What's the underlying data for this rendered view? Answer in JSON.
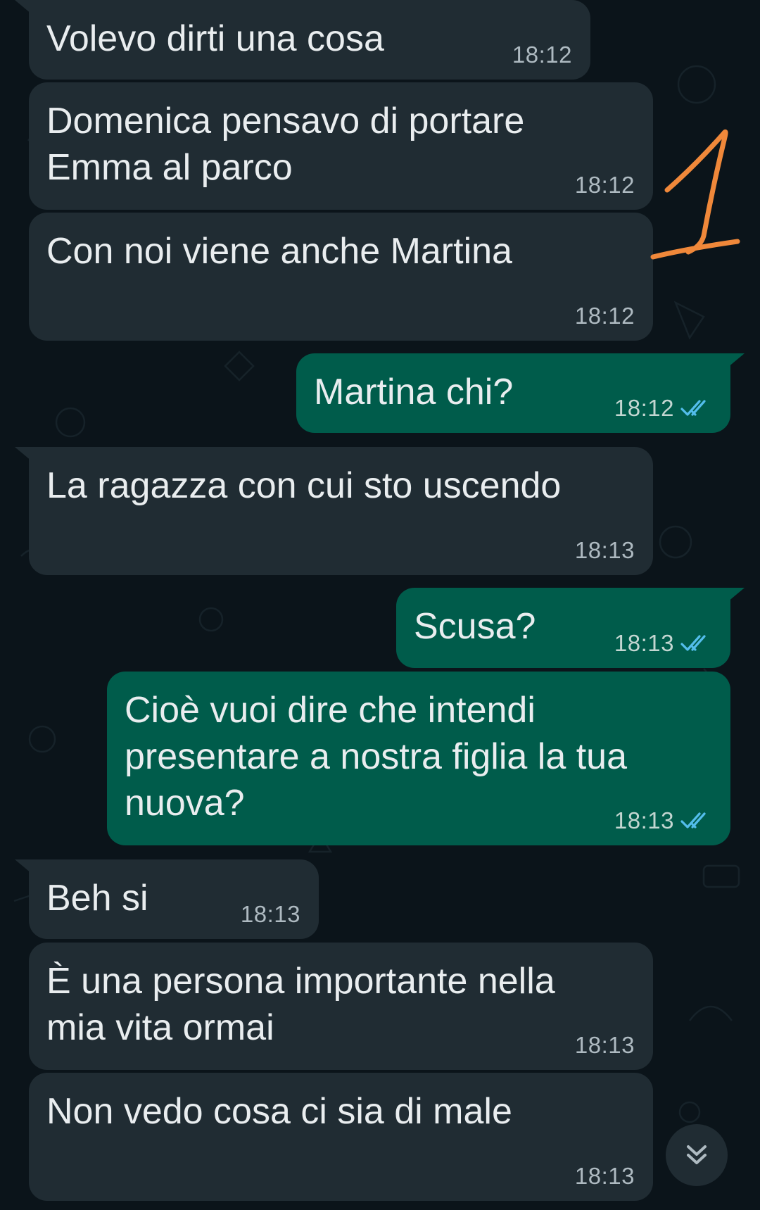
{
  "messages": [
    {
      "direction": "in",
      "text": "Volevo dirti una cosa",
      "time": "18:12"
    },
    {
      "direction": "in",
      "text": "Domenica pensavo di portare\nEmma al parco",
      "time": "18:12"
    },
    {
      "direction": "in",
      "text": "Con noi viene anche Martina",
      "time": "18:12"
    },
    {
      "direction": "out",
      "text": "Martina chi?",
      "time": "18:12",
      "status": "read"
    },
    {
      "direction": "in",
      "text": "La ragazza con cui sto uscendo",
      "time": "18:13"
    },
    {
      "direction": "out",
      "text": "Scusa?",
      "time": "18:13",
      "status": "read"
    },
    {
      "direction": "out",
      "text": "Cioè vuoi dire che intendi\npresentare a nostra figlia la tua\nnuova?",
      "time": "18:13",
      "status": "read"
    },
    {
      "direction": "in",
      "text": "Beh si",
      "time": "18:13"
    },
    {
      "direction": "in",
      "text": "È una persona importante nella\nmia vita ormai",
      "time": "18:13"
    },
    {
      "direction": "in",
      "text": "Non vedo cosa ci sia di male",
      "time": "18:13"
    }
  ],
  "annotation": {
    "text": "1",
    "color": "#f0883a"
  },
  "icons": {
    "read_receipt": "double-check-icon",
    "scroll_down": "double-chevron-down-icon"
  },
  "colors": {
    "background": "#0b141a",
    "incoming_bubble": "#202c33",
    "outgoing_bubble": "#005c4b",
    "read_tick": "#53bdeb",
    "text": "#e9edef",
    "meta": "#aebac1"
  }
}
